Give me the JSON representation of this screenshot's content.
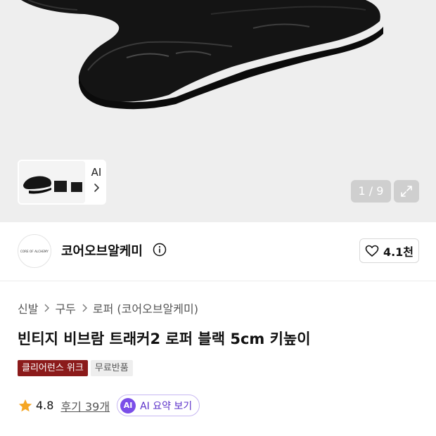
{
  "gallery": {
    "thumb_label": "AI",
    "counter": "1 / 9"
  },
  "brand": {
    "logo_text": "CORE OF ALCHEMY",
    "name": "코어오브알케미",
    "like_count": "4.1천"
  },
  "breadcrumb": {
    "items": [
      "신발",
      "구두",
      "로퍼 (코어오브알케미)"
    ]
  },
  "product": {
    "title": "빈티지 비브람 트래커2 로퍼 블랙 5cm 키높이",
    "badges": [
      "클리어런스 위크",
      "무료반품"
    ],
    "rating": "4.8",
    "reviews": "후기 39개",
    "ai_badge": "AI",
    "ai_summary": "AI 요약 보기"
  },
  "colors": {
    "clearance_badge": "#8b1a1a",
    "ai_accent": "#7a4ee8",
    "star": "#f5a623"
  }
}
